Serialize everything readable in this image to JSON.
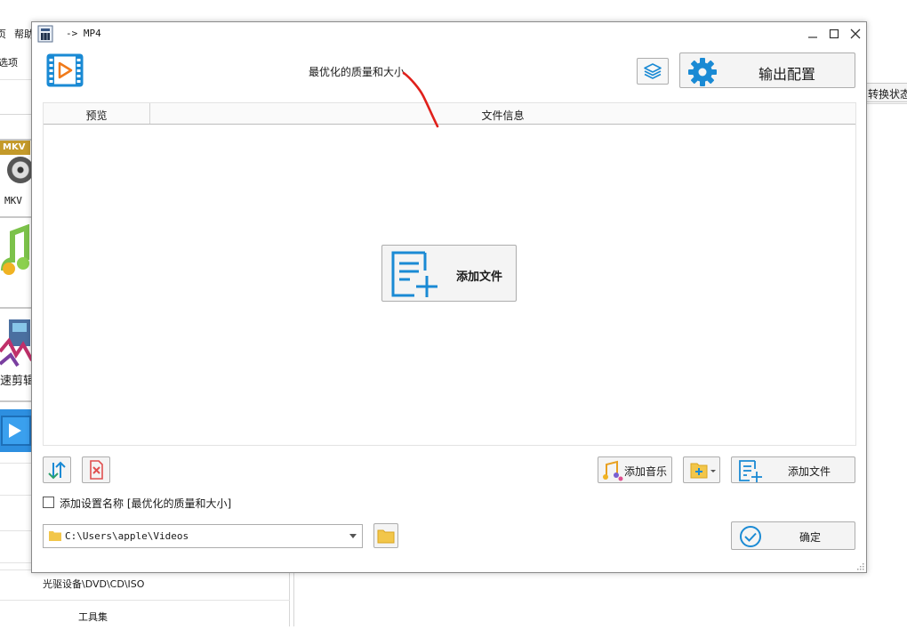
{
  "background_app": {
    "menu": [
      "页",
      "帮助"
    ],
    "toolbar_label": "选项",
    "mkv_badge": "MKV",
    "mkv_label": "MKV",
    "edit_label": "速剪辑",
    "right_tab": "转换状态",
    "bottom_items": [
      "光驱设备\\DVD\\CD\\ISO",
      "工具集"
    ]
  },
  "dialog": {
    "title": "-> MP4",
    "header_title": "最优化的质量和大小",
    "output_config_label": "输出配置",
    "columns": {
      "preview": "预览",
      "file_info": "文件信息"
    },
    "add_file_big_label": "添加文件",
    "add_music_label": "添加音乐",
    "add_file_label": "添加文件",
    "checkbox_label": "添加设置名称 [最优化的质量和大小]",
    "checkbox_checked": false,
    "output_path": "C:\\Users\\apple\\Videos",
    "ok_label": "确定"
  },
  "colors": {
    "accent_blue": "#1a8ad4",
    "annotation_red": "#e0201b",
    "delete_red": "#e05050"
  },
  "icons": [
    "app-icon",
    "video-logo-icon",
    "layers-icon",
    "gear-icon",
    "add-file-icon",
    "sort-icon",
    "delete-icon",
    "music-icon",
    "folder-add-icon",
    "folder-icon",
    "ok-check-icon",
    "minimize-icon",
    "maximize-icon",
    "close-icon"
  ]
}
